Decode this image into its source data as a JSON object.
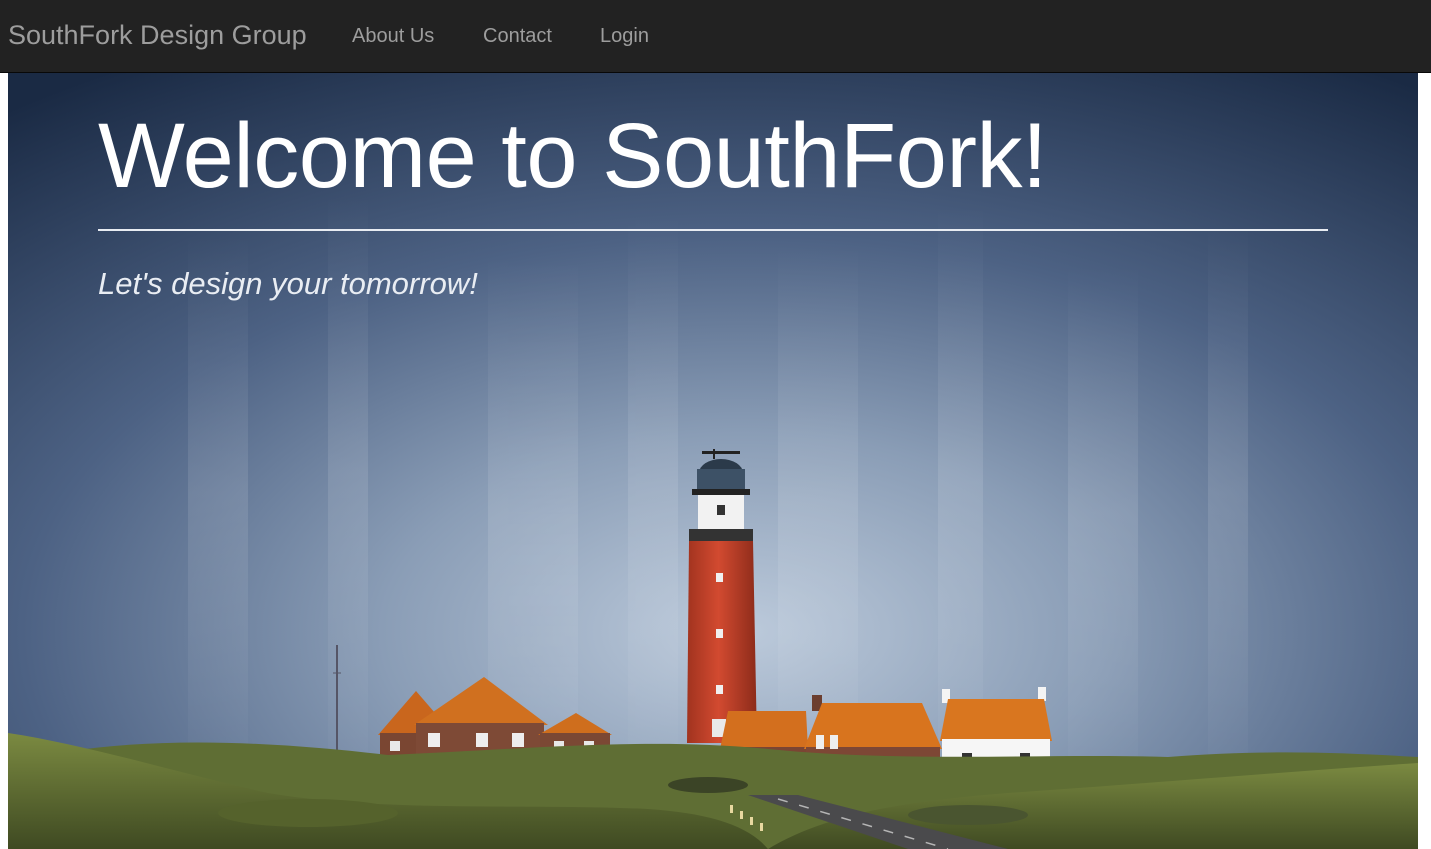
{
  "navbar": {
    "brand": "SouthFork Design Group",
    "links": [
      {
        "label": "About Us"
      },
      {
        "label": "Contact"
      },
      {
        "label": "Login"
      }
    ]
  },
  "hero": {
    "title": "Welcome to SouthFork!",
    "tagline": "Let's design your tomorrow!",
    "image": "lighthouse-photo"
  },
  "colors": {
    "navbar_bg": "#222222",
    "nav_text": "#9d9d9d",
    "hero_text": "#ffffff",
    "sky_dark": "#1c2c45",
    "sky_light": "#b7c5d6",
    "lighthouse_red": "#c2412c",
    "roof_orange": "#d8741e",
    "grass": "#6f7d3a"
  }
}
